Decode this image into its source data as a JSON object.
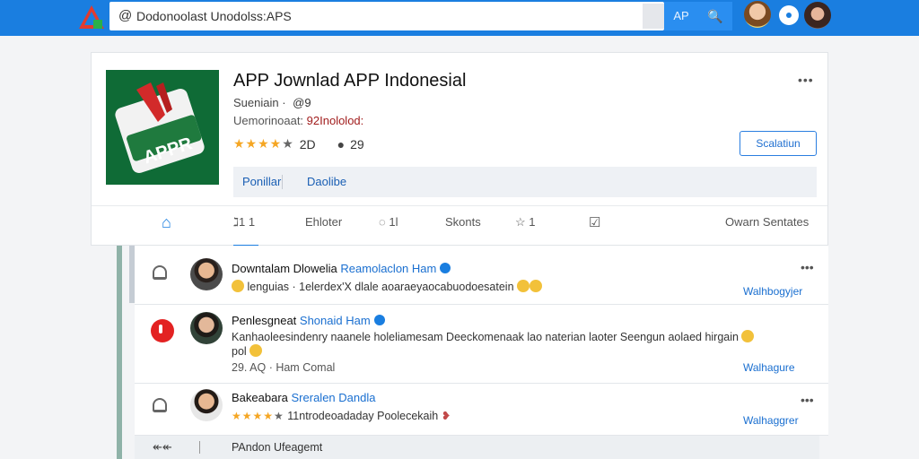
{
  "search": {
    "at": "@",
    "query": "Dodonoolast Unodolss:APS"
  },
  "topbar": {
    "tab_label": "AP",
    "search_label": "🔍"
  },
  "app": {
    "title": "APP Jownlad APP Indonesial",
    "icon_label": "APPR",
    "meta1": "Sueniain · ",
    "meta1_icon": "@9",
    "meta2_prefix": "Uemorinoaat: ",
    "meta2_value": "92Inololod:",
    "rating_count": "2D",
    "comment_count": "29",
    "subscribe": "Scalatiun",
    "more": "•••",
    "links": [
      "Ponillar",
      "Daolibe"
    ]
  },
  "tabs": [
    {
      "label": "⌂",
      "name": "tab-home"
    },
    {
      "label": "ℷ1 1",
      "name": "tab-threads"
    },
    {
      "label": "Ehloter",
      "name": "tab-filter"
    },
    {
      "label": "◌ 1l",
      "name": "tab-comments"
    },
    {
      "label": "Skonts",
      "name": "tab-shorts"
    },
    {
      "label": "☆ 1",
      "name": "tab-favorites"
    },
    {
      "label": "☑",
      "name": "tab-check"
    },
    {
      "label": "Owarn Sentates",
      "name": "tab-owner"
    }
  ],
  "posts": [
    {
      "name": "Downtalam Dlowelia",
      "handle": "Reamolaclon Ham",
      "text": "lenguias · 1elerdex'X dlale aoaraeyaocabuodoesatein",
      "link": "Walhbogyjer",
      "more": "•••"
    },
    {
      "name": "Penlesgneat",
      "handle": "Shonaid Ham",
      "text": "Kanhaoleesindenry naanele holeliamesam Deeckomenaak lao naterian laoter Seengun aolaed hirgain",
      "text2": "pol",
      "time": "29. AQ · Ham Comal",
      "link": "Walhagure"
    },
    {
      "name": "Bakeabara",
      "handle": "Sreralen Dandla",
      "text": "11ntrodeoadaday Poolecekaih",
      "link": "Walhaggrer",
      "more": "•••"
    }
  ],
  "bottom": {
    "icon": "↞↞",
    "text": "PAndon Ufeagemt"
  },
  "colors": {
    "accent": "#1a7ee0",
    "app_icon_bg": "#0f6b36",
    "star": "#f5a623",
    "alert": "#e32222"
  }
}
